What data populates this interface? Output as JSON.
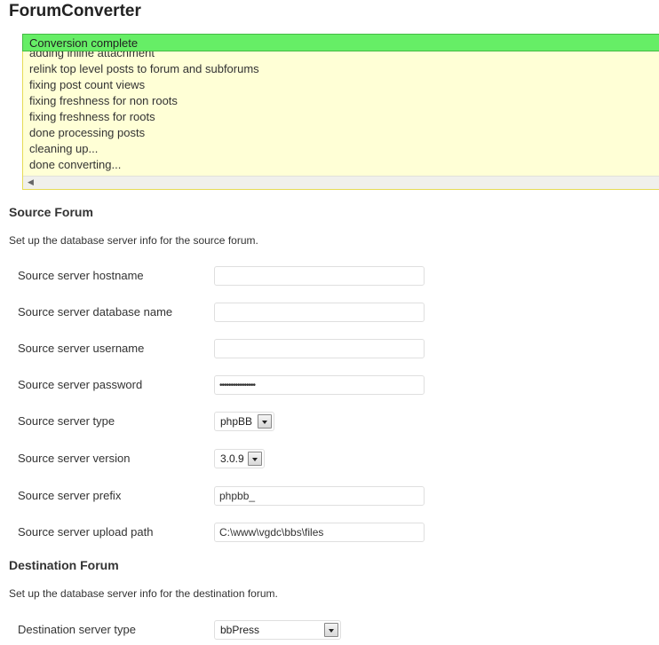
{
  "page": {
    "title": "ForumConverter"
  },
  "status": {
    "text": "Conversion complete",
    "color": "#66ee66"
  },
  "log": {
    "lines": [
      "adding inline attachment",
      "relink top level posts to forum and subforums",
      "fixing post count views",
      "fixing freshness for non roots",
      "fixing freshness for roots",
      "done processing posts",
      "cleaning up...",
      "done converting..."
    ]
  },
  "source": {
    "title": "Source Forum",
    "description": "Set up the database server info for the source forum.",
    "hostname": {
      "label": "Source server hostname",
      "value": ""
    },
    "database": {
      "label": "Source server database name",
      "value": ""
    },
    "username": {
      "label": "Source server username",
      "value": ""
    },
    "password": {
      "label": "Source server password",
      "value": "••••••••••••••••"
    },
    "type": {
      "label": "Source server type",
      "value": "phpBB"
    },
    "version": {
      "label": "Source server version",
      "value": "3.0.9"
    },
    "prefix": {
      "label": "Source server prefix",
      "value": "phpbb_"
    },
    "upload_path": {
      "label": "Source server upload path",
      "value": "C:\\www\\vgdc\\bbs\\files"
    }
  },
  "destination": {
    "title": "Destination Forum",
    "description": "Set up the database server info for the destination forum.",
    "type": {
      "label": "Destination server type",
      "value": "bbPress"
    }
  }
}
